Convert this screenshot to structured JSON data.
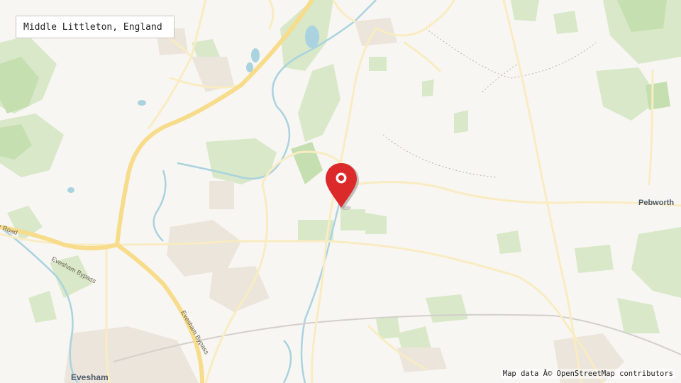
{
  "location_box": {
    "text": "Middle Littleton, England"
  },
  "attribution": {
    "text": "Map data Â© OpenStreetMap contributors"
  },
  "places": {
    "pebworth": "Pebworth",
    "evesham": "Evesham"
  },
  "roads": {
    "bypass_a": "Evesham Bypass",
    "bypass_b": "Evesham Bypass",
    "edge_road": "r Road"
  },
  "marker": {
    "icon": "map-pin-icon",
    "color": "#dc2a2a"
  },
  "colors": {
    "background": "#f8f6f2",
    "green": "#d8e8c8",
    "woodland": "#c5dfb0",
    "water": "#aad3df",
    "motorway": "#f7dc8c",
    "road": "#f9ecc2",
    "urban": "#ebe5dc"
  }
}
